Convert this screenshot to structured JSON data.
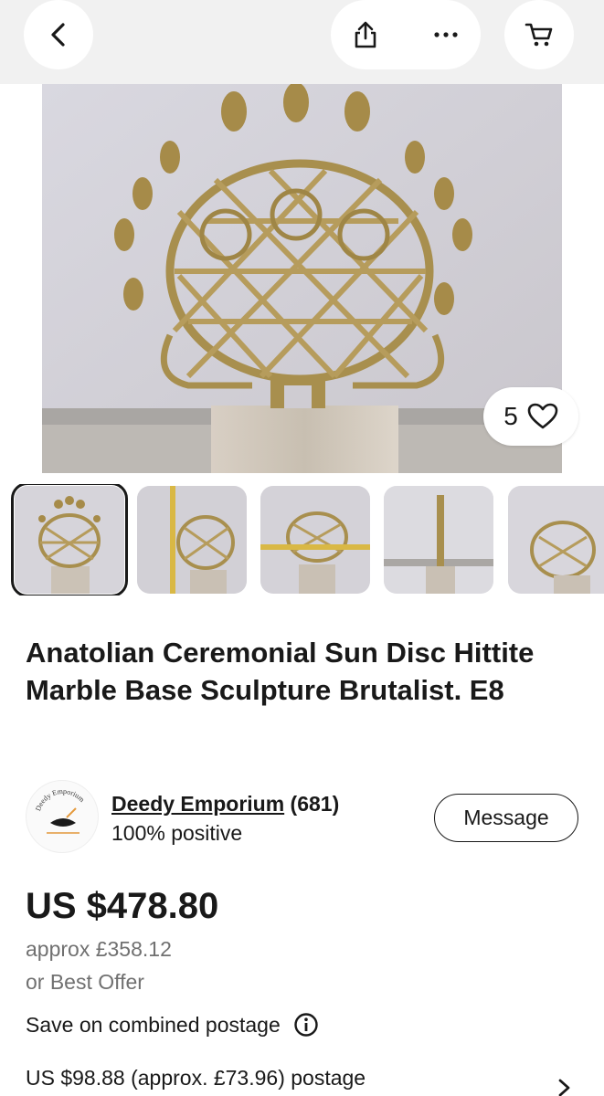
{
  "nav": {
    "back_icon": "chevron-left-icon",
    "share_icon": "share-icon",
    "more_icon": "more-horizontal-icon",
    "cart_icon": "cart-icon"
  },
  "gallery": {
    "watchers_count": "5",
    "watch_icon": "heart-outline-icon",
    "thumbnail_count": 5,
    "selected_index": 0
  },
  "listing": {
    "title": "Anatolian Ceremonial Sun Disc Hittite Marble Base Sculpture Brutalist. E8"
  },
  "seller": {
    "name": "Deedy Emporium",
    "feedback_count": "(681)",
    "positive": "100% positive",
    "message_label": "Message",
    "avatar_text": "Deedy Emporium"
  },
  "pricing": {
    "price": "US $478.80",
    "approx": "approx £358.12",
    "best_offer": "or Best Offer",
    "combined_postage": "Save on combined postage",
    "postage": "US $98.88 (approx. £73.96) postage"
  },
  "colors": {
    "text": "#191919",
    "secondary_text": "#707070",
    "topbar_bg": "#f1f1f1"
  }
}
